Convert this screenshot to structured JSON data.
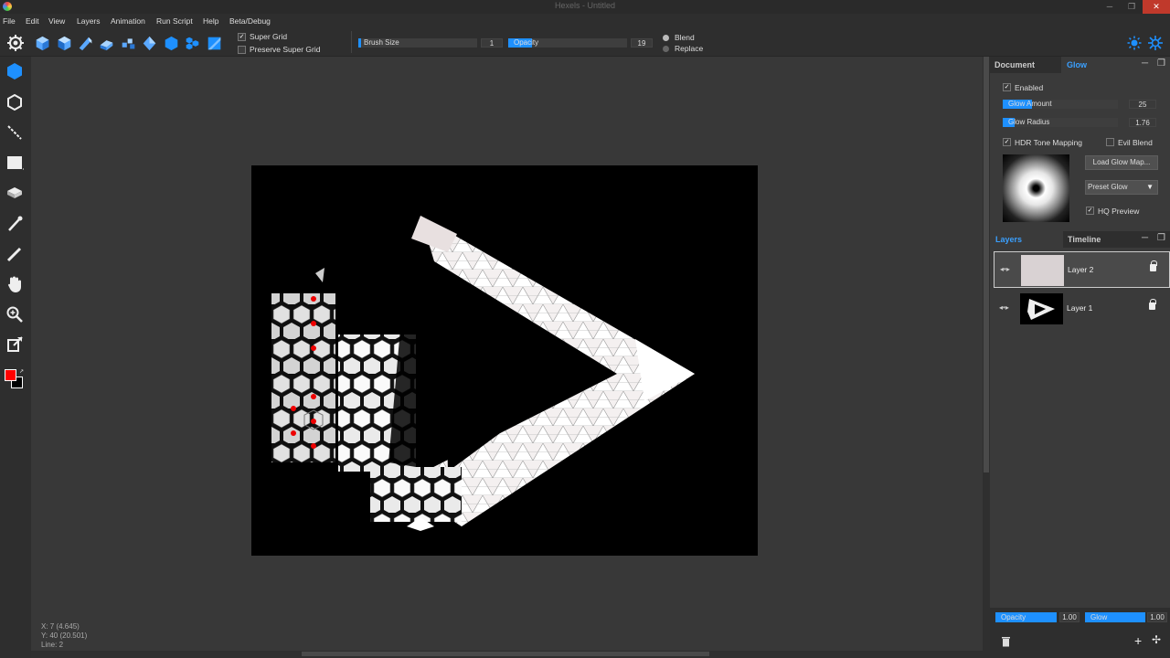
{
  "window": {
    "title": "Hexels - Untitled"
  },
  "menu": [
    "File",
    "Edit",
    "View",
    "Layers",
    "Animation",
    "Run Script",
    "Help",
    "Beta/Debug"
  ],
  "toolbar": {
    "super_grid": {
      "label": "Super Grid",
      "checked": true
    },
    "preserve_super_grid": {
      "label": "Preserve Super Grid",
      "checked": false
    },
    "brush_size": {
      "label": "Brush Size",
      "value": "1",
      "fraction": 0.02
    },
    "opacity": {
      "label": "Opacity",
      "value": "19",
      "fraction": 0.2
    },
    "blend_modes": [
      {
        "label": "Blend",
        "selected": true
      },
      {
        "label": "Replace",
        "selected": false
      }
    ],
    "check_mark": "✓"
  },
  "glow_panel": {
    "tabs": {
      "document": "Document",
      "glow": "Glow"
    },
    "enabled": {
      "label": "Enabled",
      "checked": true
    },
    "glow_amount": {
      "label": "Glow Amount",
      "value": "25",
      "fraction": 0.25
    },
    "glow_radius": {
      "label": "Glow Radius",
      "value": "1.76",
      "fraction": 0.1
    },
    "hdr_tone_mapping": {
      "label": "HDR Tone Mapping",
      "checked": true
    },
    "evil_blend": {
      "label": "Evil Blend",
      "checked": false
    },
    "load_glow_map": "Load Glow Map...",
    "preset_glow": "Preset Glow",
    "hq_preview": {
      "label": "HQ Preview",
      "checked": true
    }
  },
  "layers_panel": {
    "tabs": {
      "layers": "Layers",
      "timeline": "Timeline"
    },
    "layers": [
      {
        "name": "Layer 2",
        "selected": true
      },
      {
        "name": "Layer 1",
        "selected": false
      }
    ],
    "footer": {
      "opacity": {
        "label": "Opacity",
        "value": "1.00",
        "fraction": 1.0
      },
      "glow": {
        "label": "Glow",
        "value": "1.00",
        "fraction": 1.0
      }
    }
  },
  "status": {
    "x": "X: 7 (4.645)",
    "y": "Y: 40 (20.501)",
    "line": "Line: 2"
  },
  "colors": {
    "accent": "#1e90ff",
    "primary": "#ff0000",
    "secondary": "#000000"
  }
}
